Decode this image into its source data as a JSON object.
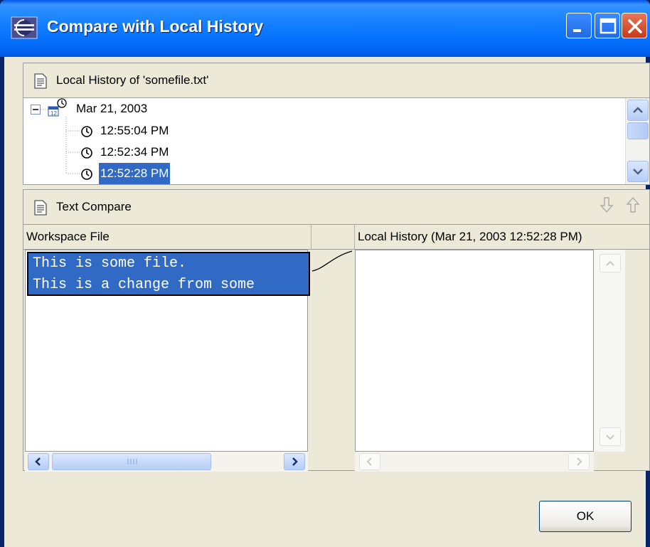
{
  "window": {
    "title": "Compare with Local History",
    "icon": "eclipse-app-icon",
    "controls": [
      "minimize-icon",
      "maximize-icon",
      "close-icon"
    ]
  },
  "history_pane": {
    "title": "Local History of 'somefile.txt'",
    "icon": "document-icon",
    "tree": {
      "date_node": {
        "label": "Mar 21, 2003",
        "expanded": true,
        "icon": "calendar-clock-icon"
      },
      "entries": [
        {
          "label": "12:55:04 PM",
          "selected": false,
          "icon": "clock-icon"
        },
        {
          "label": "12:52:34 PM",
          "selected": false,
          "icon": "clock-icon"
        },
        {
          "label": "12:52:28 PM",
          "selected": true,
          "icon": "clock-icon"
        }
      ]
    }
  },
  "compare_pane": {
    "title": "Text Compare",
    "icon": "document-icon",
    "nav_icons": [
      "next-difference-icon",
      "previous-difference-icon"
    ],
    "left_header": "Workspace File",
    "right_header": "Local History (Mar 21, 2003 12:52:28 PM)",
    "left_lines": [
      "This is some file.",
      "This is a change from some"
    ],
    "right_lines": []
  },
  "buttons": {
    "ok": "OK"
  },
  "colors": {
    "selection": "#316ac5",
    "dialog_bg": "#ece9d8",
    "titlebar": "#0058e6"
  }
}
